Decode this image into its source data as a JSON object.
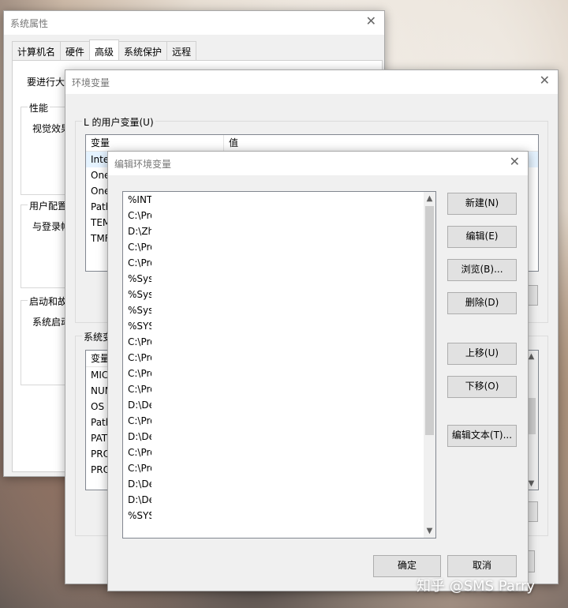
{
  "sys_props": {
    "title": "系统属性",
    "tabs": [
      "计算机名",
      "硬件",
      "高级",
      "系统保护",
      "远程"
    ],
    "admin_note": "要进行大多",
    "perf_legend": "性能",
    "perf_text": "视觉效果",
    "profile_legend": "用户配置",
    "profile_text": "与登录帐",
    "startup_legend": "启动和故",
    "startup_text": "系统启动"
  },
  "env_vars": {
    "title": "环境变量",
    "user_legend": "L 的用户变量(U)",
    "col_var": "变量",
    "col_val": "值",
    "user_rows": [
      "Inte",
      "One",
      "One",
      "Path",
      "TEM",
      "TMF"
    ],
    "system_legend": "系统变",
    "system_rows": [
      "MIC",
      "NUM",
      "OS",
      "Path",
      "PAT",
      "PRO",
      "PRO"
    ]
  },
  "edit_env": {
    "title": "编辑环境变量",
    "paths": [
      "%INT",
      "C:\\Pro",
      "D:\\Zh",
      "C:\\Pro",
      "C:\\Pro",
      "%Sys",
      "%Sys",
      "%Sys",
      "%SYS",
      "C:\\Pro",
      "C:\\Pro",
      "C:\\Pro",
      "C:\\Pro",
      "D:\\De",
      "C:\\Pro",
      "D:\\De",
      "C:\\Pro",
      "C:\\Pro",
      "D:\\De",
      "D:\\De",
      "%SYS"
    ],
    "buttons": {
      "new": "新建(N)",
      "edit": "编辑(E)",
      "browse": "浏览(B)...",
      "delete": "删除(D)",
      "move_up": "上移(U)",
      "move_down": "下移(O)",
      "edit_text": "编辑文本(T)...",
      "ok": "确定",
      "cancel": "取消"
    }
  },
  "watermark": "知乎 @SMS Parry"
}
